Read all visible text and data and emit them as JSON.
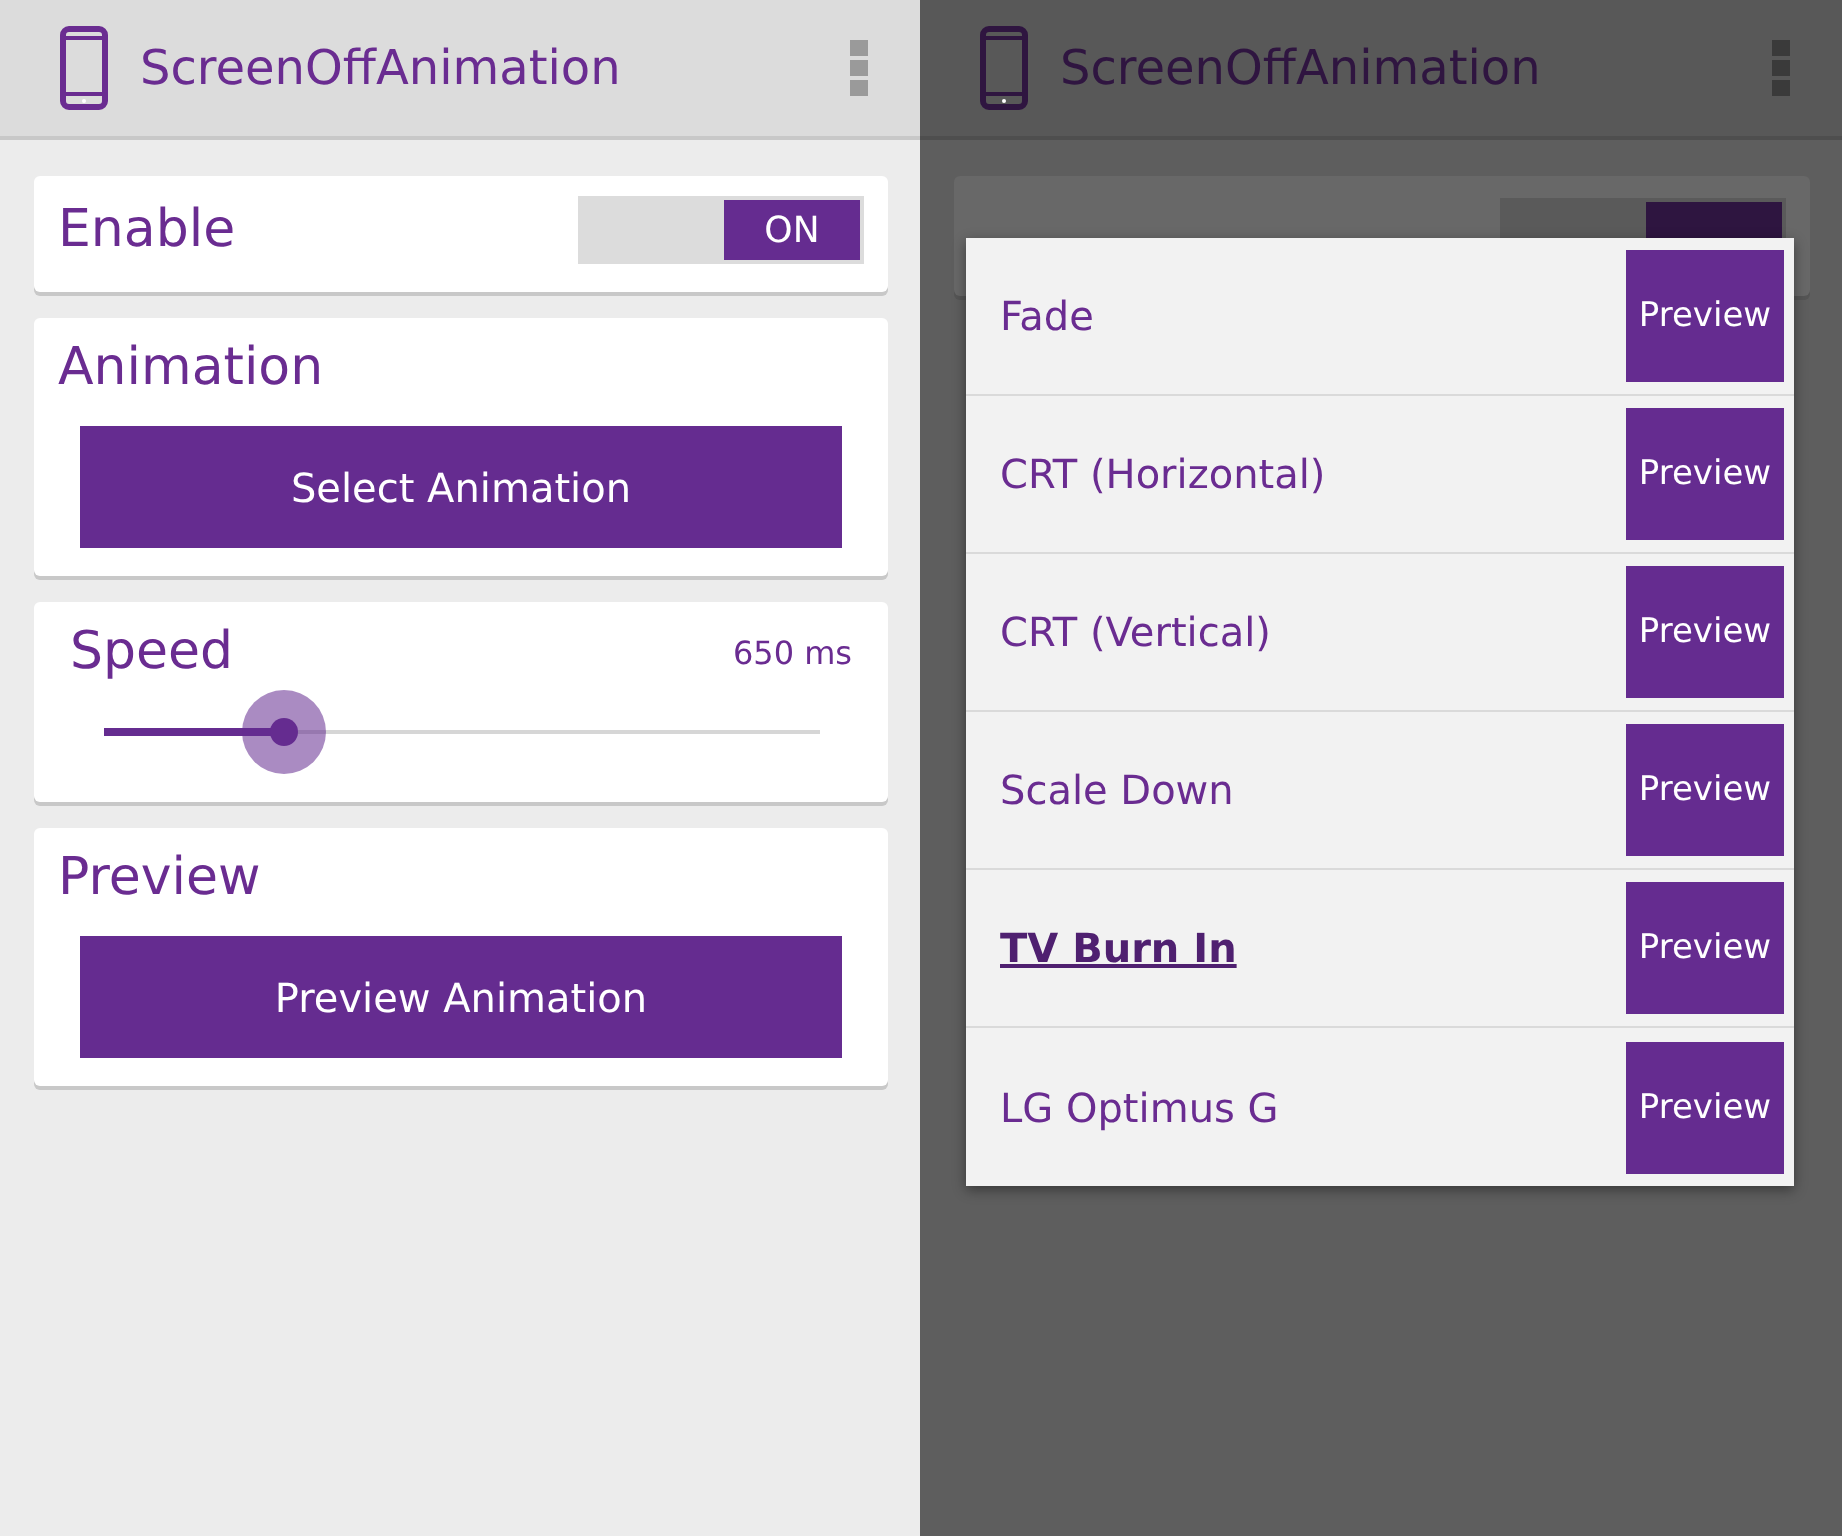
{
  "main_screen": {
    "app_bar": {
      "title": "ScreenOffAnimation"
    },
    "enable": {
      "label": "Enable",
      "toggle": {
        "label": "ON",
        "on": true
      }
    },
    "animation": {
      "title": "Animation",
      "button": "Select Animation"
    },
    "speed": {
      "title": "Speed",
      "reading": "650 ms",
      "level": 0.25
    },
    "preview": {
      "title": "Preview",
      "button": "Preview Animation"
    }
  },
  "dialog_screen": {
    "app_bar": {
      "title": "ScreenOffAnimation"
    },
    "enable_toggle": {
      "on": true
    },
    "dialog": {
      "items": [
        {
          "label": "Fade",
          "selected": false,
          "button": "Preview"
        },
        {
          "label": "CRT (Horizontal)",
          "selected": false,
          "button": "Preview"
        },
        {
          "label": "CRT (Vertical)",
          "selected": false,
          "button": "Preview"
        },
        {
          "label": "Scale Down",
          "selected": false,
          "button": "Preview"
        },
        {
          "label": "TV Burn In",
          "selected": true,
          "button": "Preview"
        },
        {
          "label": "LG Optimus G",
          "selected": false,
          "button": "Preview"
        }
      ]
    }
  }
}
